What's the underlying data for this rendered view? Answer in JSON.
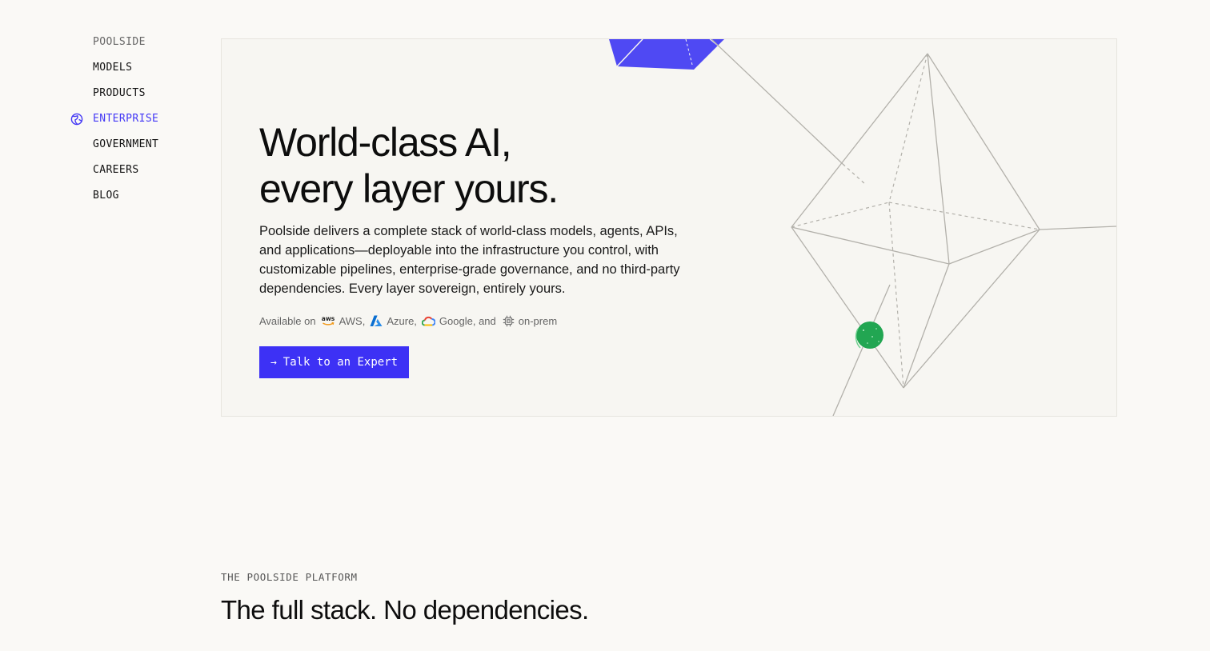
{
  "nav": {
    "brand": "POOLSIDE",
    "items": [
      {
        "label": "MODELS"
      },
      {
        "label": "PRODUCTS"
      },
      {
        "label": "ENTERPRISE",
        "active": true
      },
      {
        "label": "GOVERNMENT"
      },
      {
        "label": "CAREERS"
      },
      {
        "label": "BLOG"
      }
    ],
    "active_icon": "globe-icon"
  },
  "hero": {
    "title_line1": "World-class AI,",
    "title_line2": "every layer yours.",
    "description": "Poolside delivers a complete stack of world-class models, agents, APIs, and applications—deployable into the infrastructure you control, with customizable pipelines, enterprise-grade governance, and no third-party dependencies. Every layer sovereign, entirely yours.",
    "availability": {
      "prefix": "Available on",
      "providers": [
        {
          "icon": "aws-logo-icon",
          "label": "AWS,"
        },
        {
          "icon": "azure-logo-icon",
          "label": "Azure,"
        },
        {
          "icon": "google-cloud-logo-icon",
          "label": "Google, and"
        },
        {
          "icon": "chip-icon",
          "label": "on-prem"
        }
      ]
    },
    "cta": {
      "icon": "arrow-right-icon",
      "label": "Talk to an Expert"
    },
    "art": {
      "icon": "wireframe-octahedron",
      "shard_color": "#4f49f3",
      "sphere_color": "#22a652"
    }
  },
  "platform": {
    "eyebrow": "THE POOLSIDE PLATFORM",
    "title": "The full stack. No dependencies."
  },
  "colors": {
    "background": "#faf9f6",
    "accent": "#3d31f5",
    "active_nav": "#4338f5"
  }
}
